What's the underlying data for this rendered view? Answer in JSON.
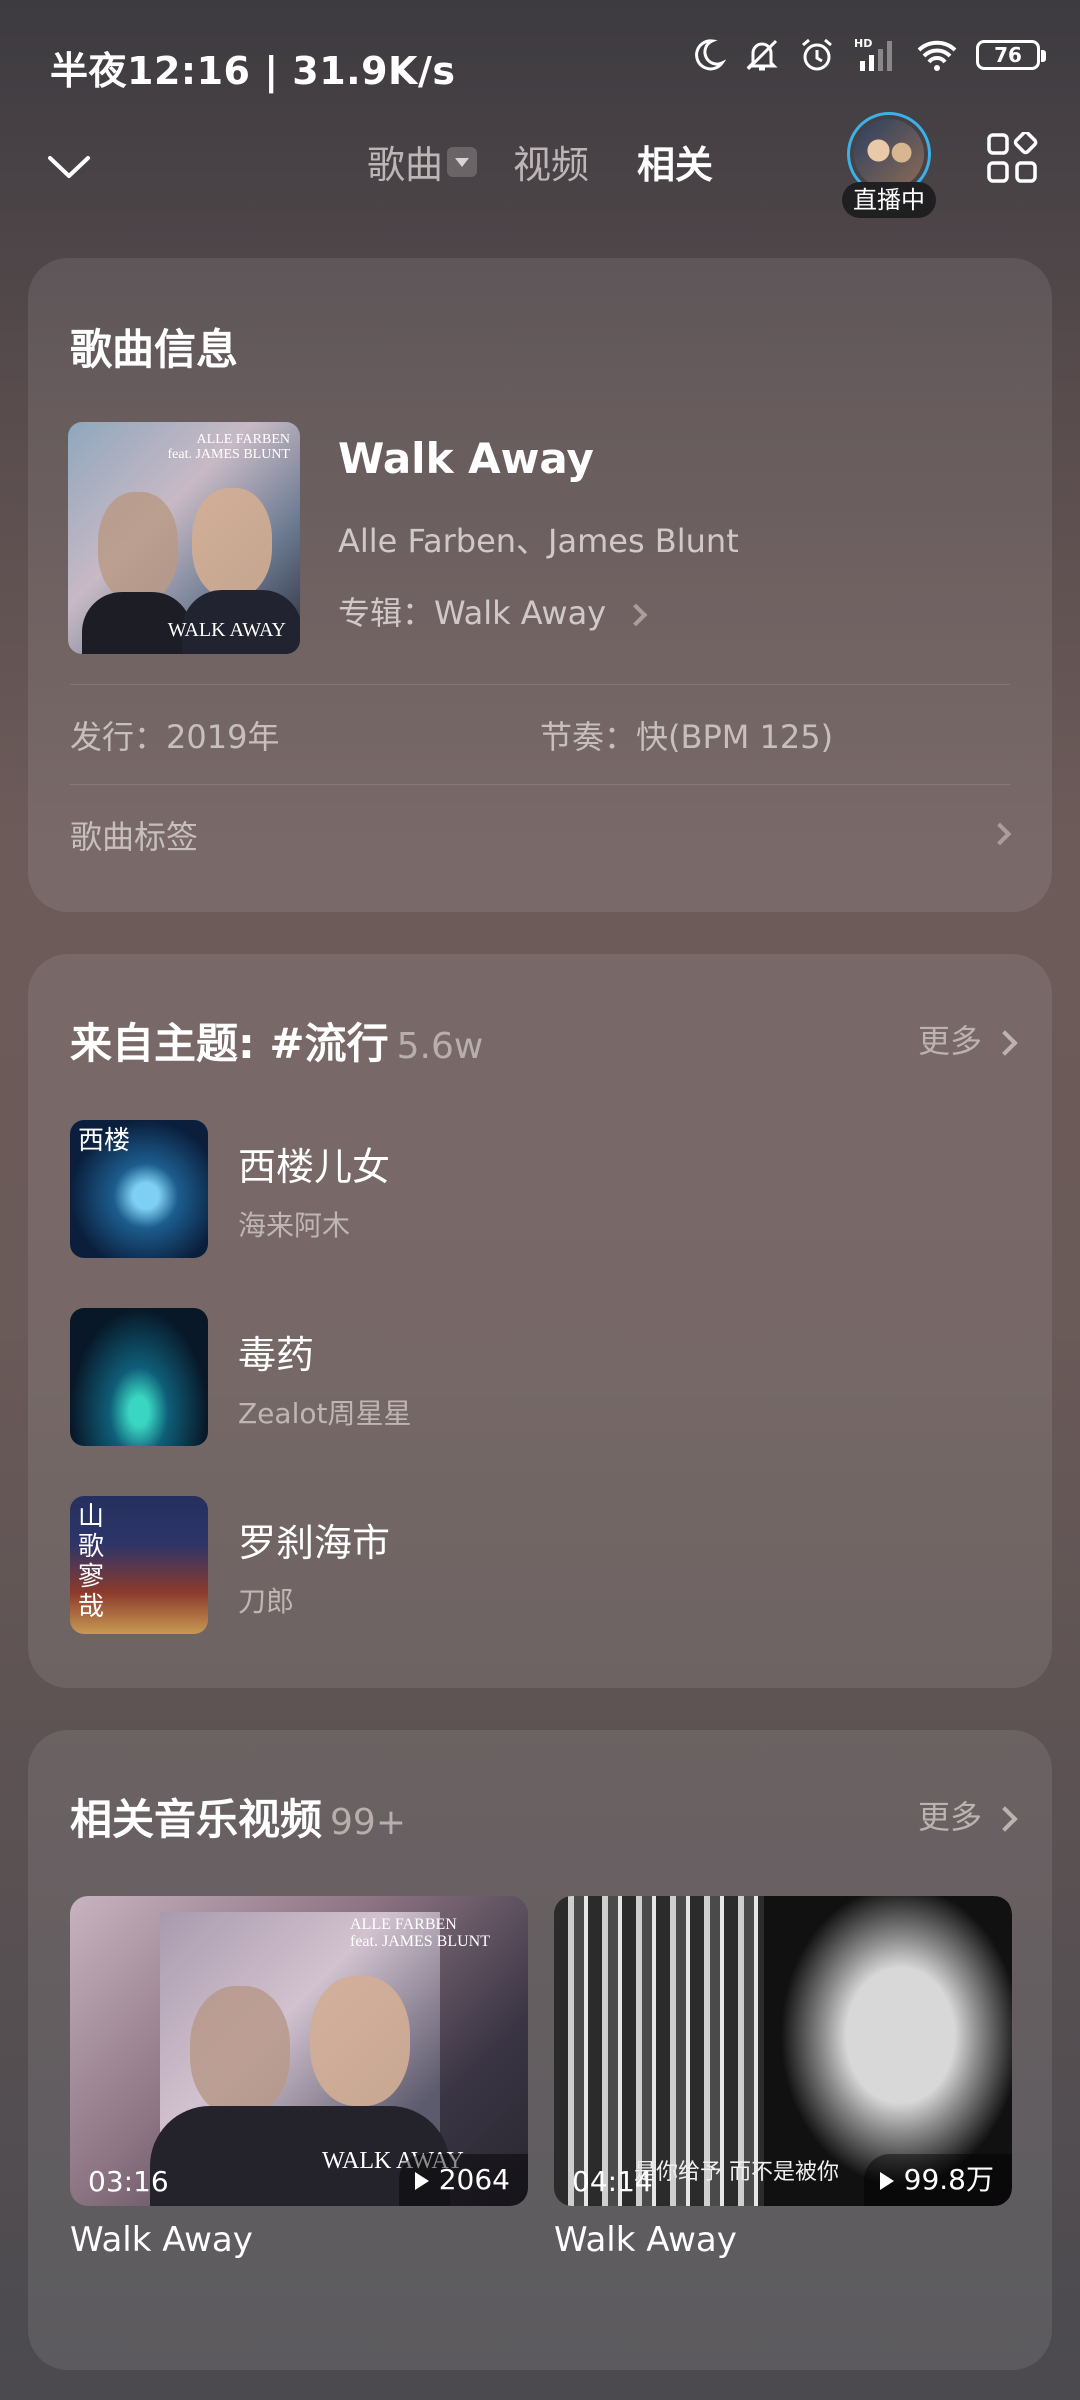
{
  "status_bar": {
    "time": "半夜12:16 | 31.9K/s",
    "battery": "76"
  },
  "nav": {
    "tabs": [
      {
        "label": "歌曲",
        "active": false,
        "has_dropdown": true
      },
      {
        "label": "视频",
        "active": false
      },
      {
        "label": "相关",
        "active": true
      }
    ],
    "live_label": "直播中"
  },
  "song_info": {
    "title": "歌曲信息",
    "song_name": "Walk Away",
    "artists": "Alle Farben、James Blunt",
    "album": "专辑：Walk Away",
    "release": "发行：2019年",
    "tempo": "节奏：快(BPM 125)",
    "tags_label": "歌曲标签",
    "cover_text_top": "ALLE FARBEN\nfeat. JAMES BLUNT",
    "cover_text_bottom": "WALK AWAY"
  },
  "theme_section": {
    "title": "来自主题: #流行",
    "count": "5.6w",
    "more_label": "更多",
    "items": [
      {
        "name": "西楼儿女",
        "artist": "海来阿木",
        "cover_text": "西楼"
      },
      {
        "name": "毒药",
        "artist": "Zealot周星星",
        "cover_text": ""
      },
      {
        "name": "罗刹海市",
        "artist": "刀郎",
        "cover_text": "山歌寥哉"
      }
    ]
  },
  "video_section": {
    "title": "相关音乐视频",
    "count": "99+",
    "more_label": "更多",
    "videos": [
      {
        "title": "Walk Away",
        "duration": "03:16",
        "plays": "2064",
        "thumb_top": "ALLE FARBEN\nfeat. JAMES BLUNT",
        "thumb_bottom": "WALK AWAY"
      },
      {
        "title": "Walk Away",
        "duration": "04:14",
        "plays": "99.8万",
        "subtitle": "是你给予 而不是被你"
      }
    ]
  }
}
